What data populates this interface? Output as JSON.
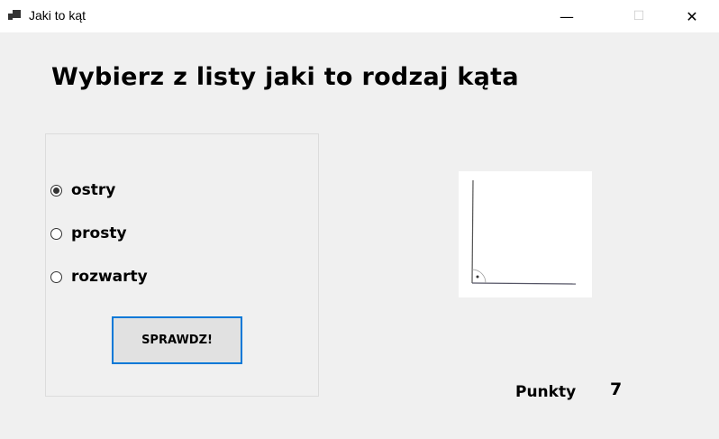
{
  "window": {
    "title": "Jaki to kąt",
    "minimize": "—",
    "maximize": "☐",
    "close": "✕"
  },
  "heading": "Wybierz z listy jaki to rodzaj kąta",
  "options": [
    {
      "label": "ostry",
      "checked": true
    },
    {
      "label": "prosty",
      "checked": false
    },
    {
      "label": "rozwarty",
      "checked": false
    }
  ],
  "check_button": "SPRAWDZ!",
  "score": {
    "label": "Punkty",
    "value": "7"
  }
}
